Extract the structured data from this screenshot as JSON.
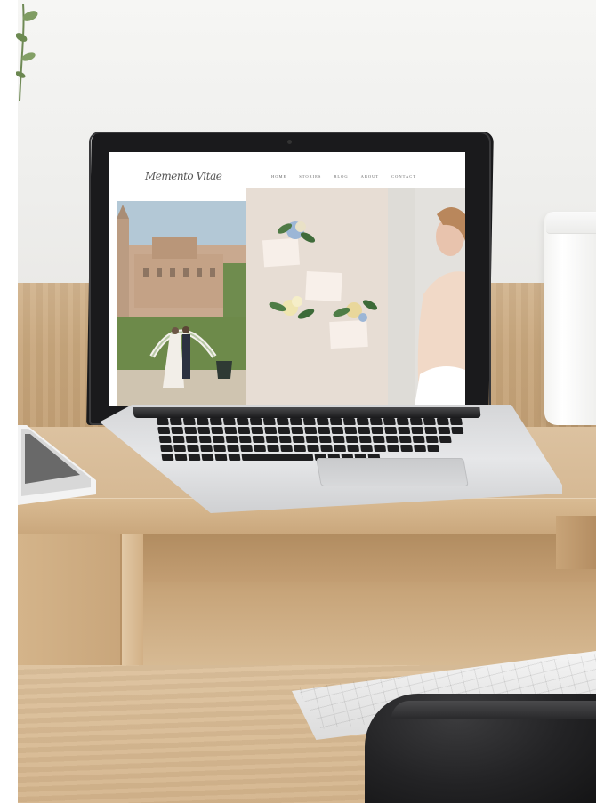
{
  "scene": {
    "description_colors": {
      "wall": "#eeeeec",
      "wood": "#d6b994",
      "laptop_bezel": "#1a1a1c",
      "laptop_body": "#dcdddf"
    }
  },
  "website": {
    "logo_text": "Memento Vitae",
    "nav": [
      "HOME",
      "STORIES",
      "BLOG",
      "ABOUT",
      "CONTACT"
    ]
  },
  "icons": {
    "plant": "plant-icon",
    "jar": "jar-icon"
  }
}
